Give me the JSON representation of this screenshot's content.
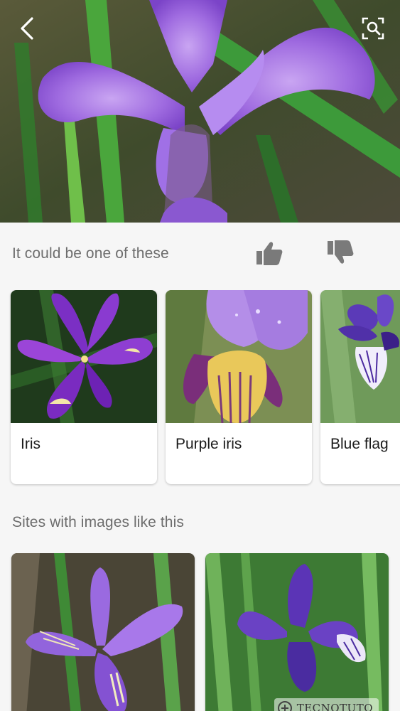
{
  "header": {
    "back_icon": "chevron-left-icon",
    "lens_icon": "visual-search-icon"
  },
  "results": {
    "title": "It could be one of these",
    "feedback": {
      "like_icon": "thumbs-up-icon",
      "dislike_icon": "thumbs-down-icon"
    },
    "cards": [
      {
        "label": "Iris"
      },
      {
        "label": "Purple iris"
      },
      {
        "label": "Blue flag"
      }
    ]
  },
  "sites": {
    "title": "Sites with images like this"
  },
  "watermark": {
    "text": "TECNOTUTO"
  },
  "colors": {
    "background": "#f6f6f6",
    "card": "#ffffff",
    "section_text": "#6d6d6d",
    "label_text": "#1b1b1b",
    "icon_gray": "#7a7a7a"
  }
}
